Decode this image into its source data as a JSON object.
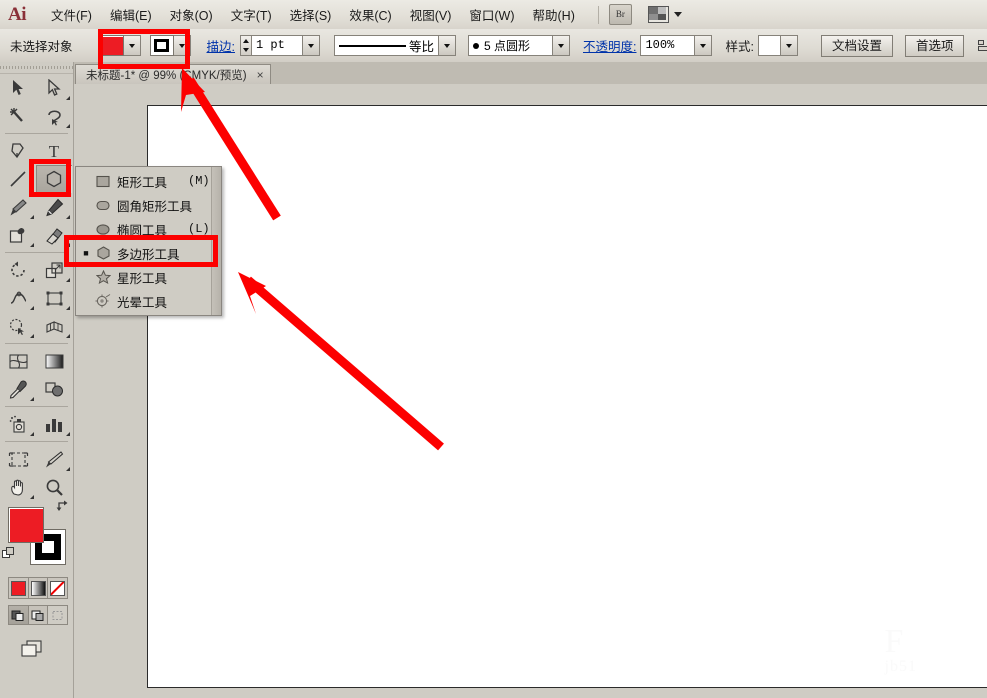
{
  "app": {
    "name": "Ai",
    "logo_text": "Ai"
  },
  "menubar": {
    "items": [
      {
        "label": "文件(F)",
        "name": "menu-file"
      },
      {
        "label": "编辑(E)",
        "name": "menu-edit"
      },
      {
        "label": "对象(O)",
        "name": "menu-object"
      },
      {
        "label": "文字(T)",
        "name": "menu-type"
      },
      {
        "label": "选择(S)",
        "name": "menu-select"
      },
      {
        "label": "效果(C)",
        "name": "menu-effect"
      },
      {
        "label": "视图(V)",
        "name": "menu-view"
      },
      {
        "label": "窗口(W)",
        "name": "menu-window"
      },
      {
        "label": "帮助(H)",
        "name": "menu-help"
      }
    ],
    "bridge_label": "Br",
    "workspace_icon": "workspace-switcher-icon"
  },
  "optionbar": {
    "selection_status": "未选择对象",
    "fill_color": "#ed1c24",
    "fill_label": "fill-swatch",
    "stroke_label": "stroke-swatch",
    "stroke_text": "描边:",
    "stroke_weight": "1 pt",
    "profile_label": "等比",
    "brush_label": "5 点圆形",
    "opacity_text": "不透明度:",
    "opacity_value": "100%",
    "style_text": "样式:",
    "doc_setup_label": "文档设置",
    "preferences_label": "首选项"
  },
  "tab": {
    "title": "未标题-1* @ 99% (CMYK/预览)",
    "close": "×"
  },
  "toolbar": {
    "tools": [
      {
        "name": "selection-tool",
        "icon": "arrow-solid"
      },
      {
        "name": "direct-selection-tool",
        "icon": "arrow-hollow"
      },
      {
        "name": "magic-wand-tool",
        "icon": "magic-wand"
      },
      {
        "name": "lasso-tool",
        "icon": "lasso"
      },
      {
        "name": "pen-tool",
        "icon": "pen"
      },
      {
        "name": "type-tool",
        "icon": "type-T"
      },
      {
        "name": "line-segment-tool",
        "icon": "line"
      },
      {
        "name": "polygon-tool",
        "icon": "polygon",
        "selected": true
      },
      {
        "name": "paintbrush-tool",
        "icon": "paintbrush"
      },
      {
        "name": "pencil-tool",
        "icon": "pencil"
      },
      {
        "name": "blob-brush-tool",
        "icon": "blob-brush"
      },
      {
        "name": "eraser-tool",
        "icon": "eraser"
      },
      {
        "name": "rotate-tool",
        "icon": "rotate"
      },
      {
        "name": "scale-tool",
        "icon": "scale"
      },
      {
        "name": "width-tool",
        "icon": "width"
      },
      {
        "name": "free-transform-tool",
        "icon": "free-transform"
      },
      {
        "name": "shape-builder-tool",
        "icon": "shape-builder"
      },
      {
        "name": "perspective-grid-tool",
        "icon": "perspective-grid"
      },
      {
        "name": "mesh-tool",
        "icon": "mesh"
      },
      {
        "name": "gradient-tool",
        "icon": "gradient"
      },
      {
        "name": "eyedropper-tool",
        "icon": "eyedropper"
      },
      {
        "name": "blend-tool",
        "icon": "blend"
      },
      {
        "name": "symbol-sprayer-tool",
        "icon": "symbol-sprayer"
      },
      {
        "name": "column-graph-tool",
        "icon": "bar-chart"
      },
      {
        "name": "artboard-tool",
        "icon": "artboard"
      },
      {
        "name": "slice-tool",
        "icon": "slice-knife"
      },
      {
        "name": "hand-tool",
        "icon": "hand"
      },
      {
        "name": "zoom-tool",
        "icon": "magnifier"
      }
    ],
    "fill_color": "#ed1c24",
    "stroke_color": "#000000",
    "swap_icon": "swap-fill-stroke-icon",
    "default_icon": "default-fill-stroke-icon",
    "mode_color": "color-mode-button",
    "mode_gradient": "gradient-mode-button",
    "mode_none": "none-mode-button",
    "draw_normal": "draw-normal-button",
    "draw_behind": "draw-behind-button",
    "draw_inside": "draw-inside-button",
    "screen_mode": "screen-mode-button"
  },
  "flyout": {
    "items": [
      {
        "label": "矩形工具",
        "shortcut": "(M)",
        "icon": "rectangle-icon",
        "bullet": "",
        "name": "flyout-rectangle-tool"
      },
      {
        "label": "圆角矩形工具",
        "shortcut": "",
        "icon": "rounded-rectangle-icon",
        "bullet": "",
        "name": "flyout-rounded-rectangle-tool"
      },
      {
        "label": "椭圆工具",
        "shortcut": "(L)",
        "icon": "ellipse-icon",
        "bullet": "",
        "name": "flyout-ellipse-tool"
      },
      {
        "label": "多边形工具",
        "shortcut": "",
        "icon": "polygon-icon",
        "bullet": "■",
        "name": "flyout-polygon-tool"
      },
      {
        "label": "星形工具",
        "shortcut": "",
        "icon": "star-icon",
        "bullet": "",
        "name": "flyout-star-tool"
      },
      {
        "label": "光晕工具",
        "shortcut": "",
        "icon": "flare-icon",
        "bullet": "",
        "name": "flyout-flare-tool"
      }
    ]
  },
  "canvas": {
    "watermark_line1": "F",
    "watermark_line2": "jb51"
  },
  "annotations": {
    "accent_color": "#fc0000",
    "box_fill_stroke": "highlight-fill-stroke-swatches",
    "box_polygon_tool": "highlight-polygon-tool-button",
    "box_polygon_menu": "highlight-polygon-menu-item",
    "arrow_to_swatches": "arrow-pointing-to-fill-stroke",
    "arrow_to_menu": "arrow-pointing-to-polygon-menu-item"
  }
}
